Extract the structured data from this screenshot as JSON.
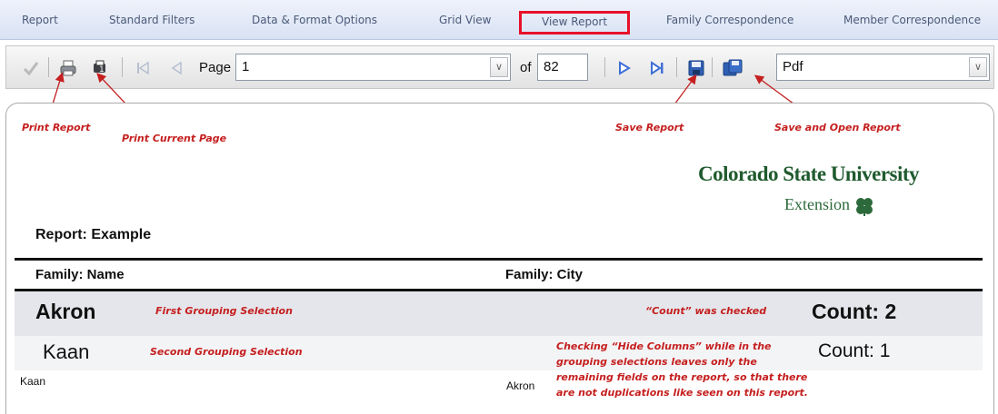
{
  "tabs": [
    {
      "label": "Report"
    },
    {
      "label": "Standard Filters"
    },
    {
      "label": "Data & Format Options"
    },
    {
      "label": "Grid View"
    },
    {
      "label": "View Report",
      "active": true
    },
    {
      "label": "Family Correspondence"
    },
    {
      "label": "Member Correspondence"
    }
  ],
  "toolbar": {
    "page_label": "Page",
    "page_value": "1",
    "of_label": "of",
    "total_pages": "82",
    "format_value": "Pdf"
  },
  "annotations": {
    "print_report": "Print Report",
    "print_current_page": "Print Current Page",
    "save_report": "Save Report",
    "save_and_open_report": "Save and Open Report",
    "first_grouping": "First Grouping Selection",
    "second_grouping": "Second Grouping Selection",
    "count_checked": "“Count” was checked",
    "hide_columns_lines": [
      "Checking “Hide Columns” while in the",
      "grouping selections leaves only the",
      "remaining fields on the report, so that there",
      "are not duplications like seen on this report."
    ]
  },
  "logo": {
    "line1": "Colorado State University",
    "line2": "Extension"
  },
  "report": {
    "title": "Report: Example",
    "col_family_name": "Family: Name",
    "col_family_city": "Family: City",
    "group1_value": "Akron",
    "group1_count": "Count: 2",
    "group2_value": "Kaan",
    "group2_count": "Count: 1",
    "row_name": "Kaan",
    "row_city": "Akron"
  },
  "colors": {
    "annotation_red": "#c51f1f",
    "active_tab_border": "#e8102a",
    "logo_green": "#1f5a2e"
  }
}
